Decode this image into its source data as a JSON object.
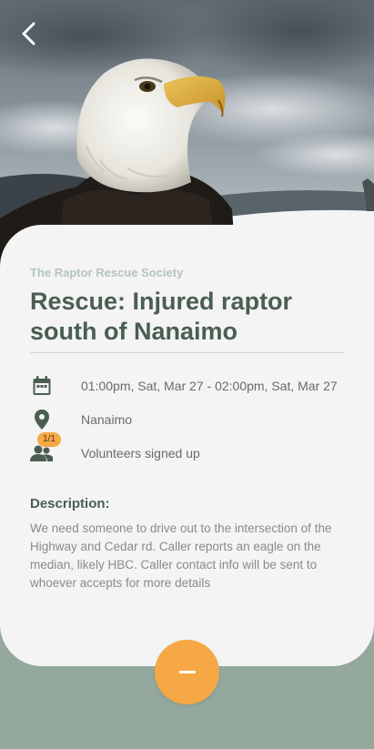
{
  "header": {
    "back_icon": "chevron-left-icon",
    "hero_image": "bald-eagle-photo"
  },
  "event": {
    "organization": "The Raptor Rescue Society",
    "title": "Rescue: Injured raptor south of Nanaimo",
    "datetime": "01:00pm, Sat, Mar 27 - 02:00pm, Sat, Mar 27",
    "location": "Nanaimo",
    "volunteer_count": "1/1",
    "volunteers_label": "Volunteers signed up",
    "icons": {
      "datetime": "calendar-icon",
      "location": "map-pin-icon",
      "volunteers": "people-icon"
    }
  },
  "description": {
    "heading": "Description:",
    "body": "We need someone to drive out to the intersection of the Highway and Cedar rd. Caller reports an eagle on the median, likely HBC. Caller contact info will be sent to whoever accepts for more details"
  },
  "action": {
    "icon": "minus-icon"
  },
  "colors": {
    "primary": "#4a5e52",
    "accent": "#f5a843",
    "card": "#f4f4f4",
    "background": "#94a89d",
    "muted_org": "#b5c4bb"
  }
}
